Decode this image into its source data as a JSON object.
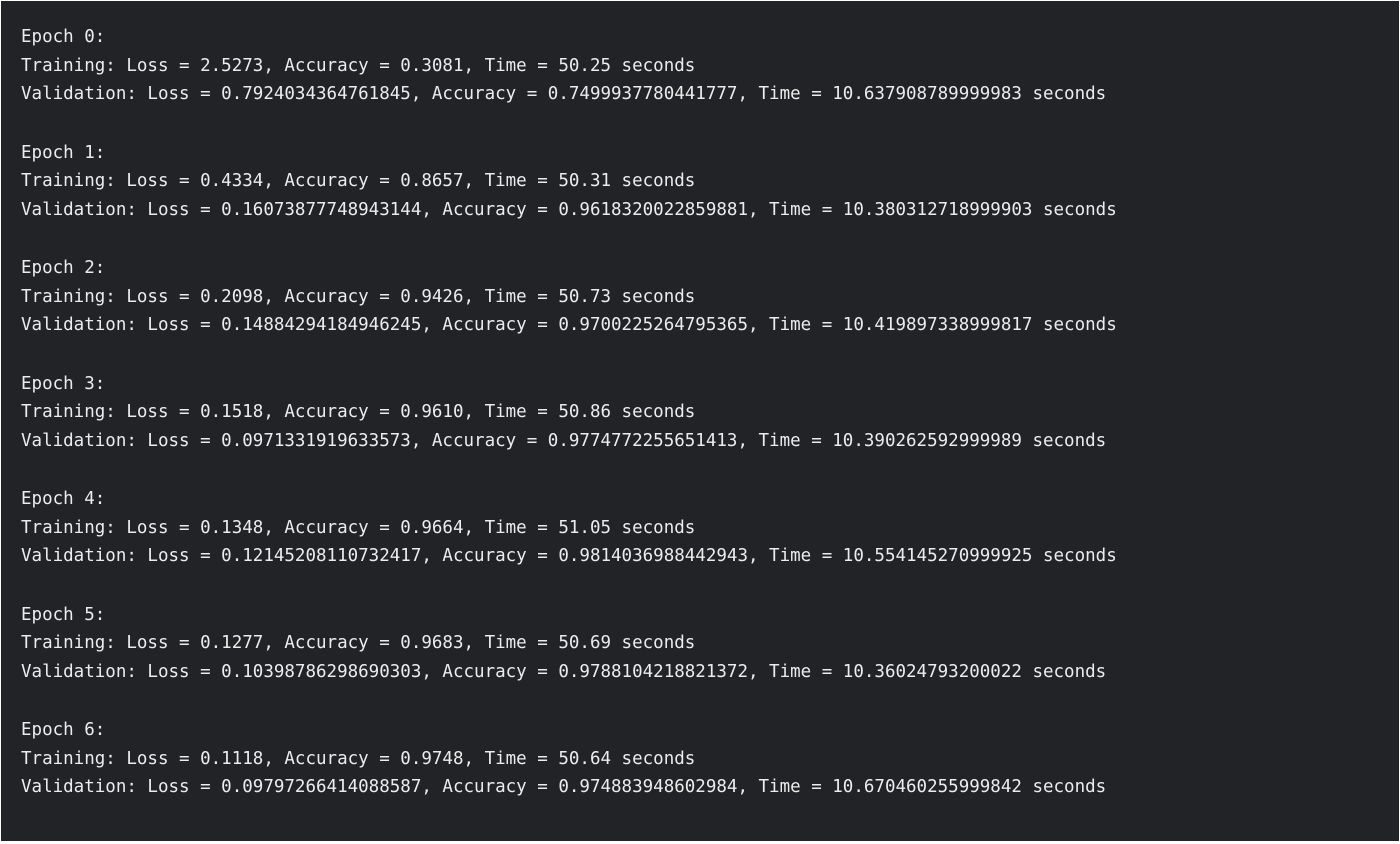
{
  "output": {
    "epochs": [
      {
        "header": "Epoch 0:",
        "training": "Training: Loss = 2.5273, Accuracy = 0.3081, Time = 50.25 seconds",
        "validation": "Validation: Loss = 0.7924034364761845, Accuracy = 0.7499937780441777, Time = 10.637908789999983 seconds"
      },
      {
        "header": "Epoch 1:",
        "training": "Training: Loss = 0.4334, Accuracy = 0.8657, Time = 50.31 seconds",
        "validation": "Validation: Loss = 0.16073877748943144, Accuracy = 0.9618320022859881, Time = 10.380312718999903 seconds"
      },
      {
        "header": "Epoch 2:",
        "training": "Training: Loss = 0.2098, Accuracy = 0.9426, Time = 50.73 seconds",
        "validation": "Validation: Loss = 0.14884294184946245, Accuracy = 0.9700225264795365, Time = 10.419897338999817 seconds"
      },
      {
        "header": "Epoch 3:",
        "training": "Training: Loss = 0.1518, Accuracy = 0.9610, Time = 50.86 seconds",
        "validation": "Validation: Loss = 0.0971331919633573, Accuracy = 0.9774772255651413, Time = 10.390262592999989 seconds"
      },
      {
        "header": "Epoch 4:",
        "training": "Training: Loss = 0.1348, Accuracy = 0.9664, Time = 51.05 seconds",
        "validation": "Validation: Loss = 0.12145208110732417, Accuracy = 0.9814036988442943, Time = 10.554145270999925 seconds"
      },
      {
        "header": "Epoch 5:",
        "training": "Training: Loss = 0.1277, Accuracy = 0.9683, Time = 50.69 seconds",
        "validation": "Validation: Loss = 0.10398786298690303, Accuracy = 0.9788104218821372, Time = 10.36024793200022 seconds"
      },
      {
        "header": "Epoch 6:",
        "training": "Training: Loss = 0.1118, Accuracy = 0.9748, Time = 50.64 seconds",
        "validation": "Validation: Loss = 0.09797266414088587, Accuracy = 0.974883948602984, Time = 10.670460255999842 seconds"
      }
    ]
  }
}
